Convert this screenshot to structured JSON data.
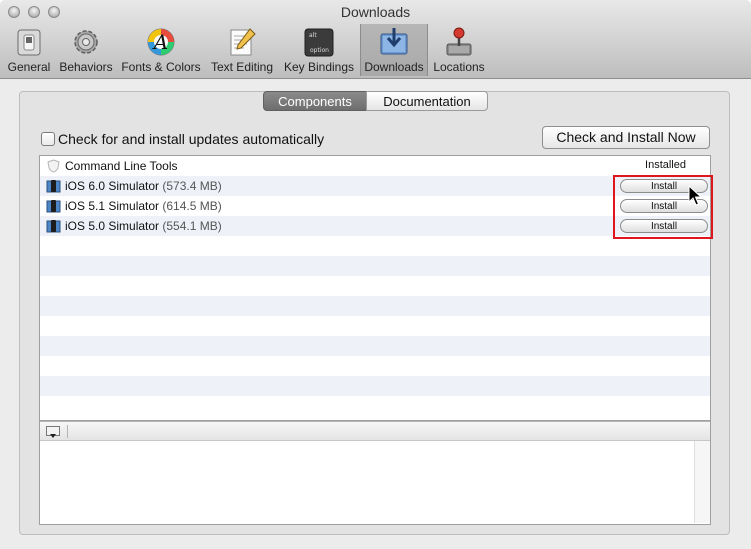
{
  "window": {
    "title": "Downloads"
  },
  "toolbar": {
    "items": [
      {
        "label": "General"
      },
      {
        "label": "Behaviors"
      },
      {
        "label": "Fonts & Colors"
      },
      {
        "label": "Text Editing"
      },
      {
        "label": "Key Bindings",
        "icon_text_top": "alt",
        "icon_text_bottom": "option"
      },
      {
        "label": "Downloads"
      },
      {
        "label": "Locations"
      }
    ],
    "selected": "Downloads"
  },
  "tabs": {
    "components": "Components",
    "documentation": "Documentation",
    "selected": "Components"
  },
  "auto_update": {
    "label": "Check for and install updates automatically",
    "checked": false
  },
  "check_button": {
    "label": "Check and Install Now"
  },
  "components": [
    {
      "name": "Command Line Tools",
      "size": "",
      "status": "Installed"
    },
    {
      "name": "iOS 6.0 Simulator",
      "size": "(573.4 MB)",
      "action": "Install"
    },
    {
      "name": "iOS 5.1 Simulator",
      "size": "(614.5 MB)",
      "action": "Install"
    },
    {
      "name": "iOS 5.0 Simulator",
      "size": "(554.1 MB)",
      "action": "Install"
    }
  ],
  "colors": {
    "highlight": "#e0161e",
    "selected_tab": "#7a7a7a",
    "alt_row": "#eef2f8"
  }
}
